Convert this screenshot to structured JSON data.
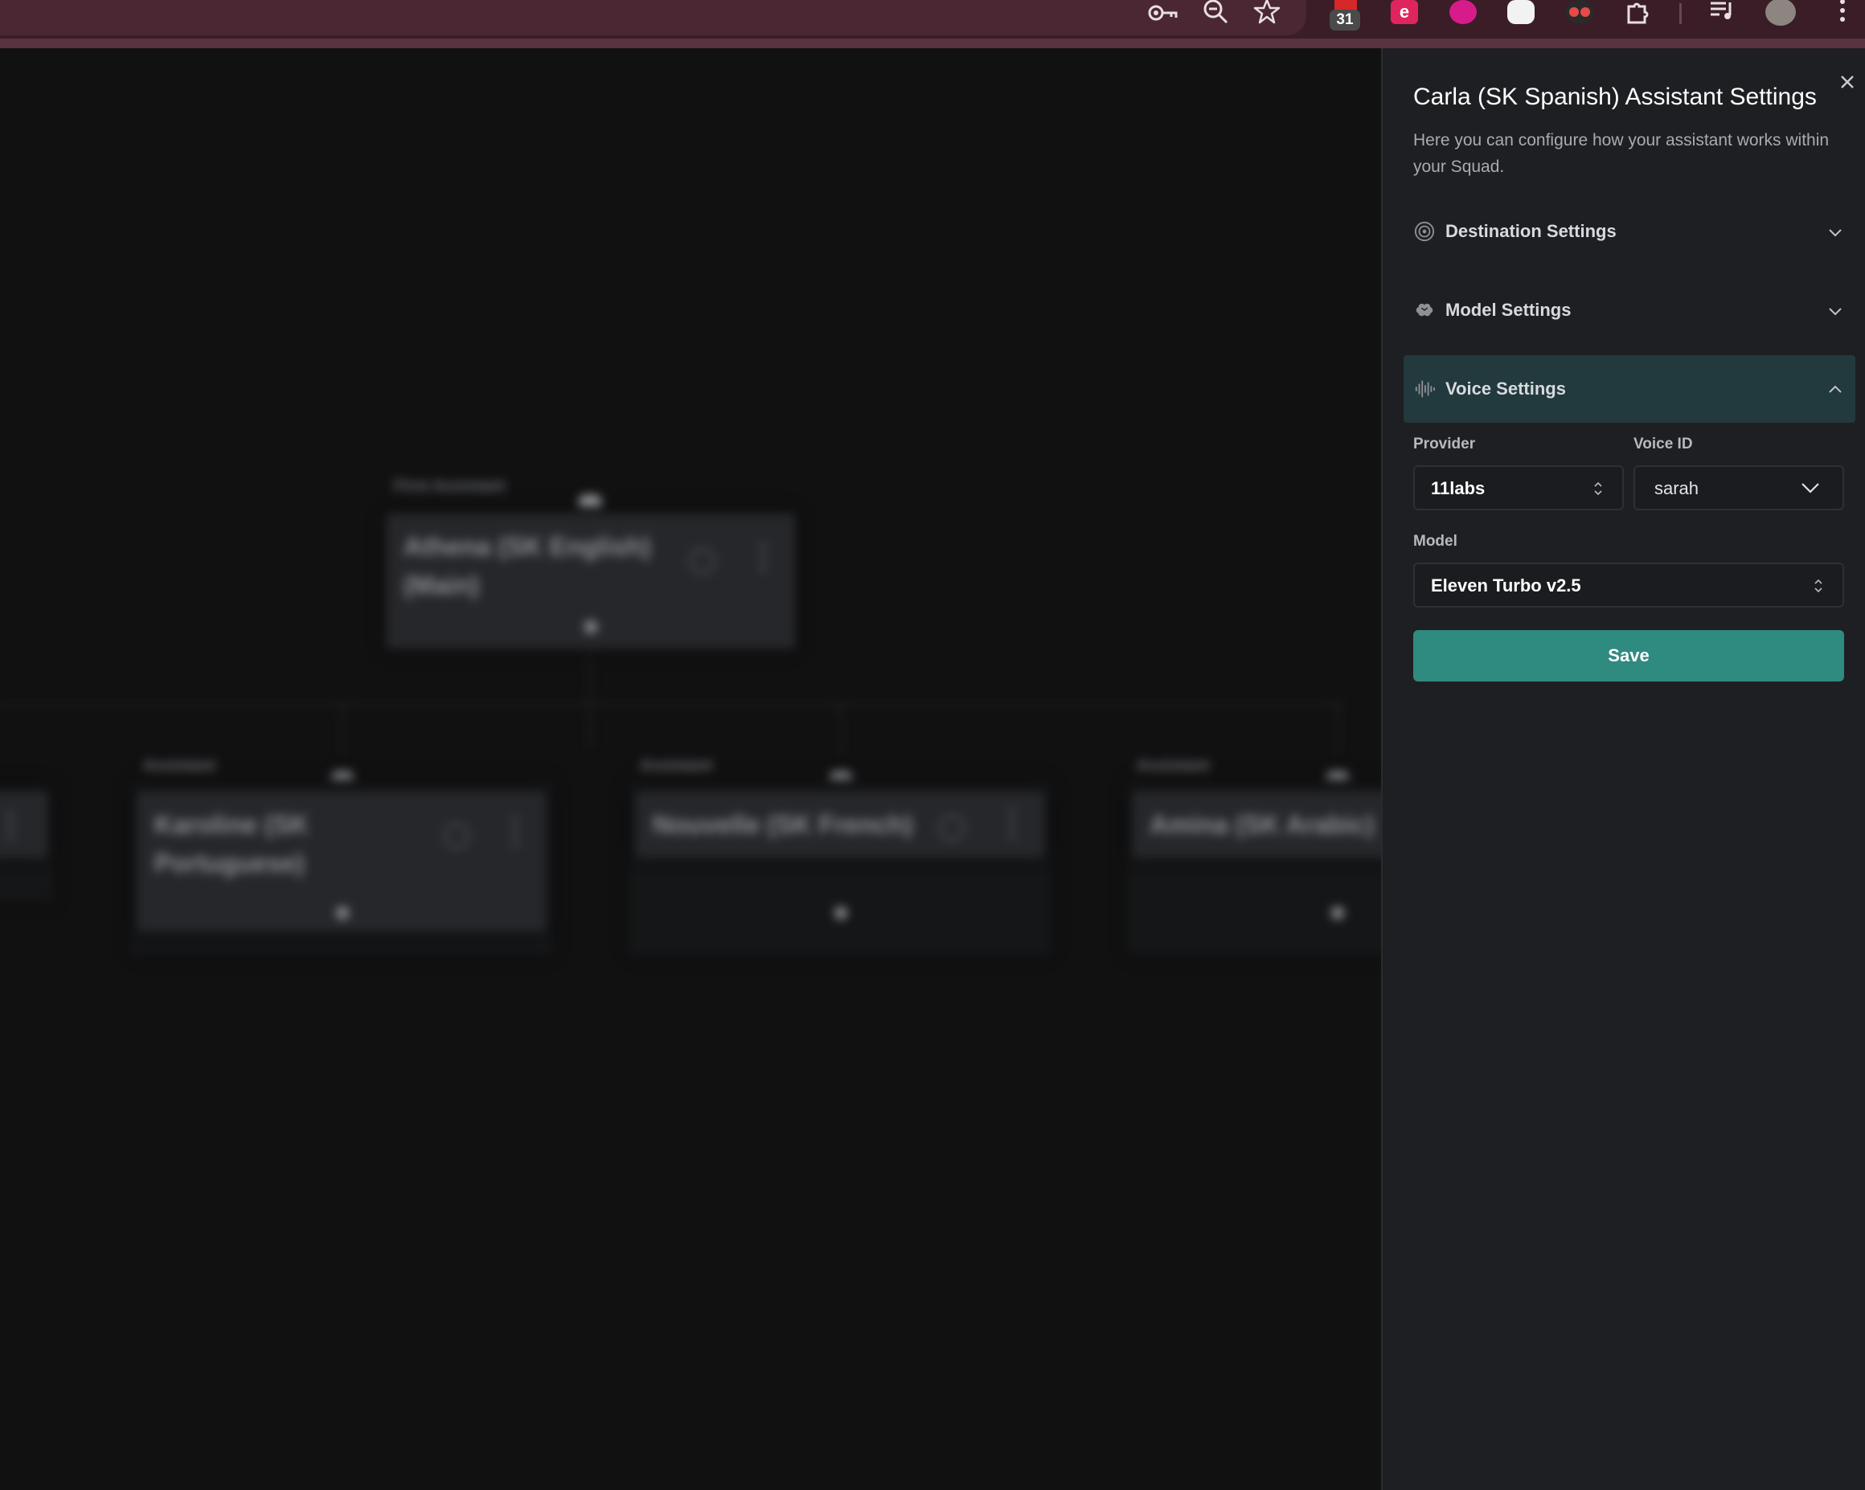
{
  "browser": {
    "badge_count": "31",
    "icons": [
      "key-icon",
      "zoom-out-icon",
      "star-icon",
      "extension-icon",
      "reading-list-icon",
      "more-icon"
    ]
  },
  "canvas": {
    "first_assistant_label": "First Assistant",
    "main_node_title": "Athena (SK English) (Main)",
    "assistant_label": "Assistant",
    "nodes": [
      {
        "title": "Karoline (SK Portuguese)"
      },
      {
        "title": "Nouvelle (SK French)"
      },
      {
        "title": "Amina (SK Arabic)"
      }
    ]
  },
  "panel": {
    "title": "Carla (SK Spanish) Assistant Settings",
    "description": "Here you can configure how your assistant works within your Squad.",
    "sections": {
      "destination": "Destination Settings",
      "model": "Model Settings",
      "voice": "Voice Settings"
    },
    "voice": {
      "provider_label": "Provider",
      "provider_value": "11labs",
      "voice_id_label": "Voice ID",
      "voice_id_value": "sarah",
      "model_label": "Model",
      "model_value": "Eleven Turbo v2.5"
    },
    "save_label": "Save"
  },
  "colors": {
    "accent": "#2f8a80",
    "active_section_bg": "#22393d",
    "panel_bg": "#1e1f22",
    "topbar_bg": "#3a1d27"
  }
}
